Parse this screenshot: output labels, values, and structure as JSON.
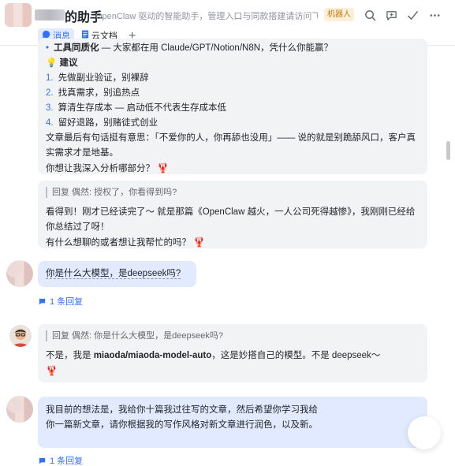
{
  "header": {
    "title": "的助手",
    "description": "OpenClaw 驱动的智能助手，管理入口与同款搭建请访问飞书...",
    "badge": "机器人",
    "tabs": [
      {
        "label": "消息"
      },
      {
        "label": "云文档"
      },
      {
        "label": "+"
      }
    ]
  },
  "message1": {
    "bullet": "•",
    "line1_bold": "工具同质化",
    "line1_rest": " — 大家都在用 Claude/GPT/Notion/N8N，凭什么你能赢？",
    "section_icon": "💡",
    "section_title": "建议",
    "items": [
      {
        "num": "1.",
        "text": "先做副业验证，别裸辞"
      },
      {
        "num": "2.",
        "text": "找真需求，别追热点"
      },
      {
        "num": "3.",
        "text": "算清生存成本 — 启动低不代表生存成本低"
      },
      {
        "num": "4.",
        "text": "留好退路，别赌徒式创业"
      }
    ],
    "para1": "文章最后有句话挺有意思：「不爱你的人，你再舔也没用」—— 说的就是别跪舔风口，客户真实需求才是地基。",
    "para2": "你想让我深入分析哪部分？",
    "emoji": "🦞"
  },
  "message2": {
    "quote": "回复 偶然: 授权了，你看得到吗?",
    "line1": "看得到！刚才已经读完了～ 就是那篇《OpenClaw 越火，一人公司死得越惨》，我刚刚已经给你总结过了呀！",
    "line2": "有什么想聊的或者想让我帮忙的吗？",
    "emoji": "🦞"
  },
  "message3": {
    "text": "你是什么大模型，是deepseek吗?",
    "reply_count": "1 条回复"
  },
  "message4": {
    "quote": "回复 偶然: 你是什么大模型，是deepseek吗?",
    "text_a": "不是，我是 ",
    "text_bold": "miaoda/miaoda-model-auto",
    "text_b": "，这是妙搭自己的模型。不是 deepseek～",
    "emoji": "🦞"
  },
  "message5": {
    "text": "我目前的想法是，我给你十篇我过往写的文章，然后希望你学习我给你一篇新文章，请你根据我的写作风格对新文章进行润色，以及新。",
    "reply_count": "1 条回复"
  },
  "colors": {
    "accent": "#3370ff",
    "bubble_gray": "#f2f3f5",
    "bubble_blue": "#e1eaff",
    "badge_bg": "#fdefd8",
    "badge_fg": "#c57b0e"
  },
  "icons": {
    "search": "search-icon",
    "add-chat": "add-chat-icon",
    "share": "share-icon",
    "check": "check-icon",
    "more": "more-icon"
  }
}
